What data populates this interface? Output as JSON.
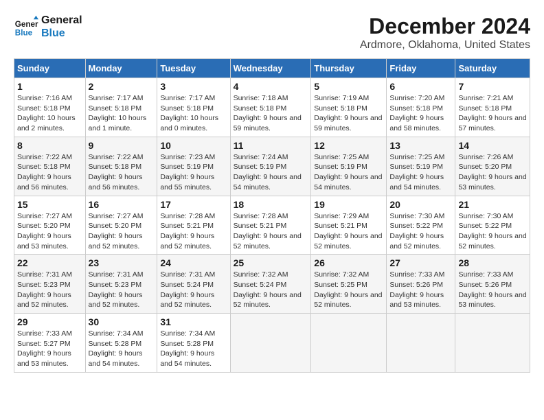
{
  "logo": {
    "text_general": "General",
    "text_blue": "Blue"
  },
  "title": "December 2024",
  "subtitle": "Ardmore, Oklahoma, United States",
  "weekdays": [
    "Sunday",
    "Monday",
    "Tuesday",
    "Wednesday",
    "Thursday",
    "Friday",
    "Saturday"
  ],
  "weeks": [
    [
      {
        "day": "1",
        "sunrise": "Sunrise: 7:16 AM",
        "sunset": "Sunset: 5:18 PM",
        "daylight": "Daylight: 10 hours and 2 minutes."
      },
      {
        "day": "2",
        "sunrise": "Sunrise: 7:17 AM",
        "sunset": "Sunset: 5:18 PM",
        "daylight": "Daylight: 10 hours and 1 minute."
      },
      {
        "day": "3",
        "sunrise": "Sunrise: 7:17 AM",
        "sunset": "Sunset: 5:18 PM",
        "daylight": "Daylight: 10 hours and 0 minutes."
      },
      {
        "day": "4",
        "sunrise": "Sunrise: 7:18 AM",
        "sunset": "Sunset: 5:18 PM",
        "daylight": "Daylight: 9 hours and 59 minutes."
      },
      {
        "day": "5",
        "sunrise": "Sunrise: 7:19 AM",
        "sunset": "Sunset: 5:18 PM",
        "daylight": "Daylight: 9 hours and 59 minutes."
      },
      {
        "day": "6",
        "sunrise": "Sunrise: 7:20 AM",
        "sunset": "Sunset: 5:18 PM",
        "daylight": "Daylight: 9 hours and 58 minutes."
      },
      {
        "day": "7",
        "sunrise": "Sunrise: 7:21 AM",
        "sunset": "Sunset: 5:18 PM",
        "daylight": "Daylight: 9 hours and 57 minutes."
      }
    ],
    [
      {
        "day": "8",
        "sunrise": "Sunrise: 7:22 AM",
        "sunset": "Sunset: 5:18 PM",
        "daylight": "Daylight: 9 hours and 56 minutes."
      },
      {
        "day": "9",
        "sunrise": "Sunrise: 7:22 AM",
        "sunset": "Sunset: 5:18 PM",
        "daylight": "Daylight: 9 hours and 56 minutes."
      },
      {
        "day": "10",
        "sunrise": "Sunrise: 7:23 AM",
        "sunset": "Sunset: 5:19 PM",
        "daylight": "Daylight: 9 hours and 55 minutes."
      },
      {
        "day": "11",
        "sunrise": "Sunrise: 7:24 AM",
        "sunset": "Sunset: 5:19 PM",
        "daylight": "Daylight: 9 hours and 54 minutes."
      },
      {
        "day": "12",
        "sunrise": "Sunrise: 7:25 AM",
        "sunset": "Sunset: 5:19 PM",
        "daylight": "Daylight: 9 hours and 54 minutes."
      },
      {
        "day": "13",
        "sunrise": "Sunrise: 7:25 AM",
        "sunset": "Sunset: 5:19 PM",
        "daylight": "Daylight: 9 hours and 54 minutes."
      },
      {
        "day": "14",
        "sunrise": "Sunrise: 7:26 AM",
        "sunset": "Sunset: 5:20 PM",
        "daylight": "Daylight: 9 hours and 53 minutes."
      }
    ],
    [
      {
        "day": "15",
        "sunrise": "Sunrise: 7:27 AM",
        "sunset": "Sunset: 5:20 PM",
        "daylight": "Daylight: 9 hours and 53 minutes."
      },
      {
        "day": "16",
        "sunrise": "Sunrise: 7:27 AM",
        "sunset": "Sunset: 5:20 PM",
        "daylight": "Daylight: 9 hours and 52 minutes."
      },
      {
        "day": "17",
        "sunrise": "Sunrise: 7:28 AM",
        "sunset": "Sunset: 5:21 PM",
        "daylight": "Daylight: 9 hours and 52 minutes."
      },
      {
        "day": "18",
        "sunrise": "Sunrise: 7:28 AM",
        "sunset": "Sunset: 5:21 PM",
        "daylight": "Daylight: 9 hours and 52 minutes."
      },
      {
        "day": "19",
        "sunrise": "Sunrise: 7:29 AM",
        "sunset": "Sunset: 5:21 PM",
        "daylight": "Daylight: 9 hours and 52 minutes."
      },
      {
        "day": "20",
        "sunrise": "Sunrise: 7:30 AM",
        "sunset": "Sunset: 5:22 PM",
        "daylight": "Daylight: 9 hours and 52 minutes."
      },
      {
        "day": "21",
        "sunrise": "Sunrise: 7:30 AM",
        "sunset": "Sunset: 5:22 PM",
        "daylight": "Daylight: 9 hours and 52 minutes."
      }
    ],
    [
      {
        "day": "22",
        "sunrise": "Sunrise: 7:31 AM",
        "sunset": "Sunset: 5:23 PM",
        "daylight": "Daylight: 9 hours and 52 minutes."
      },
      {
        "day": "23",
        "sunrise": "Sunrise: 7:31 AM",
        "sunset": "Sunset: 5:23 PM",
        "daylight": "Daylight: 9 hours and 52 minutes."
      },
      {
        "day": "24",
        "sunrise": "Sunrise: 7:31 AM",
        "sunset": "Sunset: 5:24 PM",
        "daylight": "Daylight: 9 hours and 52 minutes."
      },
      {
        "day": "25",
        "sunrise": "Sunrise: 7:32 AM",
        "sunset": "Sunset: 5:24 PM",
        "daylight": "Daylight: 9 hours and 52 minutes."
      },
      {
        "day": "26",
        "sunrise": "Sunrise: 7:32 AM",
        "sunset": "Sunset: 5:25 PM",
        "daylight": "Daylight: 9 hours and 52 minutes."
      },
      {
        "day": "27",
        "sunrise": "Sunrise: 7:33 AM",
        "sunset": "Sunset: 5:26 PM",
        "daylight": "Daylight: 9 hours and 53 minutes."
      },
      {
        "day": "28",
        "sunrise": "Sunrise: 7:33 AM",
        "sunset": "Sunset: 5:26 PM",
        "daylight": "Daylight: 9 hours and 53 minutes."
      }
    ],
    [
      {
        "day": "29",
        "sunrise": "Sunrise: 7:33 AM",
        "sunset": "Sunset: 5:27 PM",
        "daylight": "Daylight: 9 hours and 53 minutes."
      },
      {
        "day": "30",
        "sunrise": "Sunrise: 7:34 AM",
        "sunset": "Sunset: 5:28 PM",
        "daylight": "Daylight: 9 hours and 54 minutes."
      },
      {
        "day": "31",
        "sunrise": "Sunrise: 7:34 AM",
        "sunset": "Sunset: 5:28 PM",
        "daylight": "Daylight: 9 hours and 54 minutes."
      },
      null,
      null,
      null,
      null
    ]
  ]
}
